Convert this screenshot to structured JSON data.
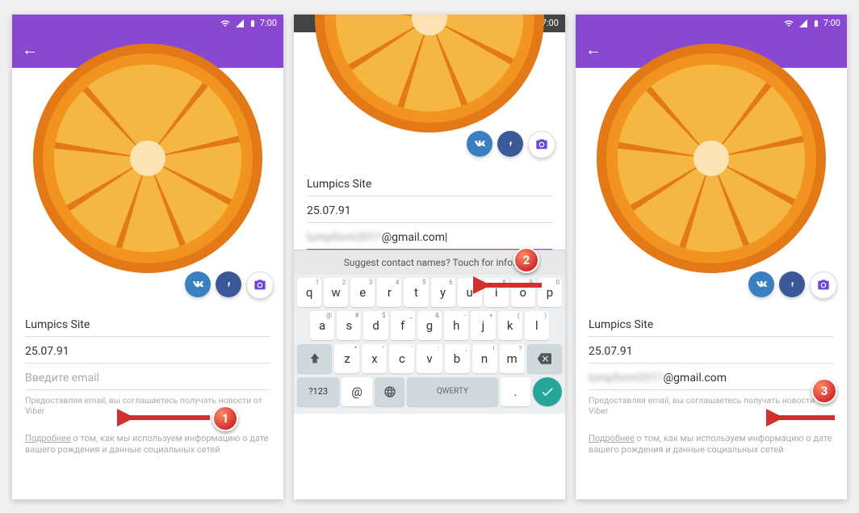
{
  "status": {
    "time": "7:00"
  },
  "profile": {
    "name": "Lumpics Site",
    "date": "25.07.91",
    "email_placeholder": "Введите email",
    "email_value_suffix": "@gmail.com",
    "email_value_blur": "lumpform2017",
    "hint": "Предоставляя email, вы соглашаетесь получать новости от Viber",
    "more_prefix": "Подробнее",
    "more_rest": " о том, как мы используем информацию о дате вашего рождения и данные социальных сетей"
  },
  "keyboard": {
    "suggestion": "Suggest contact names? Touch for info.",
    "row1": [
      {
        "k": "q",
        "s": "1"
      },
      {
        "k": "w",
        "s": "2"
      },
      {
        "k": "e",
        "s": "3"
      },
      {
        "k": "r",
        "s": "4"
      },
      {
        "k": "t",
        "s": "5"
      },
      {
        "k": "y",
        "s": "6"
      },
      {
        "k": "u",
        "s": "7"
      },
      {
        "k": "i",
        "s": "8"
      },
      {
        "k": "o",
        "s": "9"
      },
      {
        "k": "p",
        "s": "0"
      }
    ],
    "row2": [
      {
        "k": "a",
        "s": "@"
      },
      {
        "k": "s",
        "s": "#"
      },
      {
        "k": "d",
        "s": "$"
      },
      {
        "k": "f",
        "s": "_"
      },
      {
        "k": "g",
        "s": "&"
      },
      {
        "k": "h",
        "s": "-"
      },
      {
        "k": "j",
        "s": "+"
      },
      {
        "k": "k",
        "s": "("
      },
      {
        "k": "l",
        "s": ")"
      }
    ],
    "row3": [
      {
        "k": "z",
        "s": "*"
      },
      {
        "k": "x",
        "s": "\""
      },
      {
        "k": "c",
        "s": "'"
      },
      {
        "k": "v",
        "s": ":"
      },
      {
        "k": "b",
        "s": ";"
      },
      {
        "k": "n",
        "s": "!"
      },
      {
        "k": "m",
        "s": "?"
      }
    ],
    "numKey": "?123",
    "atKey": "@",
    "spaceLabel": "QWERTY",
    "dotKey": "."
  },
  "steps": {
    "one": "1",
    "two": "2",
    "three": "3"
  }
}
